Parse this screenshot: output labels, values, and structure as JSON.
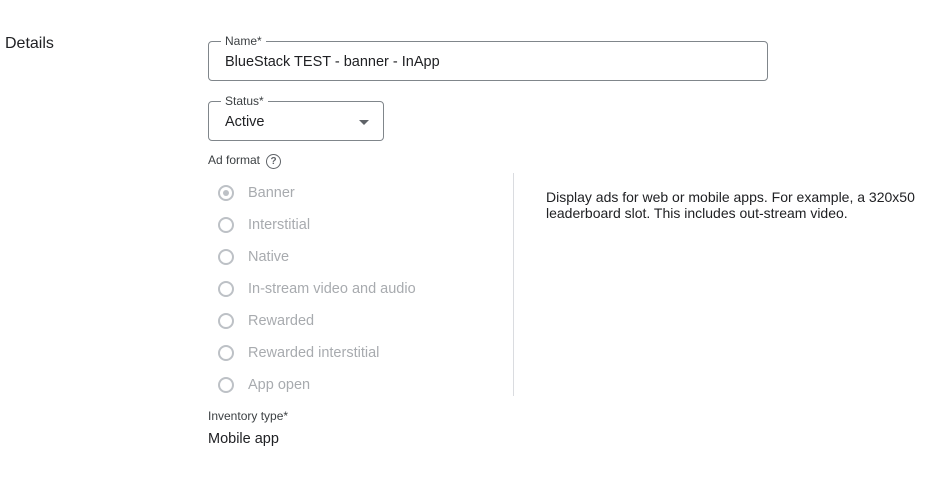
{
  "section": {
    "title": "Details"
  },
  "name_field": {
    "label": "Name*",
    "value": "BlueStack TEST - banner - InApp"
  },
  "status_field": {
    "label": "Status*",
    "value": "Active"
  },
  "ad_format": {
    "label": "Ad format",
    "help_icon": "?",
    "options": [
      {
        "label": "Banner",
        "selected": true,
        "disabled": true
      },
      {
        "label": "Interstitial",
        "selected": false,
        "disabled": true
      },
      {
        "label": "Native",
        "selected": false,
        "disabled": true
      },
      {
        "label": "In-stream video and audio",
        "selected": false,
        "disabled": true
      },
      {
        "label": "Rewarded",
        "selected": false,
        "disabled": true
      },
      {
        "label": "Rewarded interstitial",
        "selected": false,
        "disabled": true
      },
      {
        "label": "App open",
        "selected": false,
        "disabled": true
      }
    ],
    "description": "Display ads for web or mobile apps. For example, a 320x50 leaderboard slot. This includes out-stream video."
  },
  "inventory_type": {
    "label": "Inventory type*",
    "value": "Mobile app"
  },
  "colors": {
    "text": "#202124",
    "border": "#80868b",
    "disabled_text": "#a8abaf",
    "disabled_radio": "#bdc1c6",
    "divider": "#dadce0"
  },
  "icons": {
    "help": "help-circle-icon",
    "dropdown": "caret-down-icon"
  }
}
